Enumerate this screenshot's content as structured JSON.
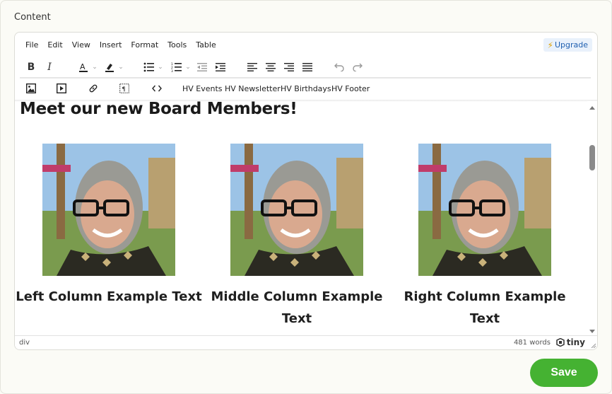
{
  "section_label": "Content",
  "menubar": {
    "items": [
      "File",
      "Edit",
      "View",
      "Insert",
      "Format",
      "Tools",
      "Table"
    ],
    "upgrade_label": "Upgrade"
  },
  "toolbar2": {
    "custom_buttons": [
      "HV Events",
      "HV Newsletter",
      "HV Birthdays",
      "HV Footer"
    ]
  },
  "content": {
    "heading": "Meet our new Board Members!",
    "columns": [
      {
        "caption": "Left Column Example Text"
      },
      {
        "caption": "Middle Column Example Text"
      },
      {
        "caption": "Right Column Example Text"
      }
    ]
  },
  "statusbar": {
    "path": "div",
    "word_count": "481 words",
    "brand": "tiny"
  },
  "save_label": "Save",
  "colors": {
    "save_green": "#45b232",
    "upgrade_blue": "#1f5fb0"
  }
}
